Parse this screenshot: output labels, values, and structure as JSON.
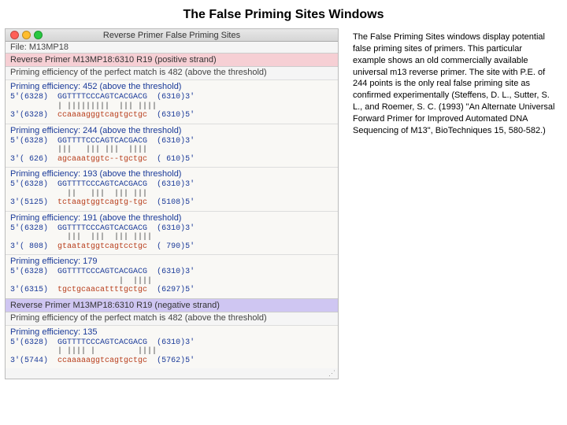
{
  "page_title": "The False Priming Sites Windows",
  "description": "The False Priming Sites windows display potential false priming sites of primers. This particular example shows an old commercially available universal m13 reverse primer. The site with P.E. of 244 points is the only real false priming site as confirmed experimentally (Steffens, D. L., Sutter, S. L., and Roemer, S. C. (1993) \"An Alternate Universal Forward Primer for Improved Automated DNA Sequencing of M13\", BioTechniques 15, 580-582.)",
  "window": {
    "title": "Reverse Primer False Priming Sites",
    "file": "File: M13MP18",
    "resize": "⋰"
  },
  "pos_strand": {
    "header": "Reverse Primer M13MP18:6310 R19 (positive strand)",
    "eff": "Priming efficiency of the perfect match is 482 (above the threshold)"
  },
  "neg_strand": {
    "header": "Reverse Primer M13MP18:6310 R19 (negative strand)",
    "eff": "Priming efficiency of the perfect match is 482 (above the threshold)"
  },
  "primer": {
    "pos5": "5'(6328)",
    "seq": "GGTTTTCCCAGTCACGACG",
    "end": "(6310)3'"
  },
  "sites_pos": [
    {
      "title": "Priming efficiency: 452 (above the threshold)",
      "align": "          | |||||||||  ||| ||||",
      "bpos": "3'(6328)",
      "bseq": "ccaaaagggtcagtgctgc",
      "bend": "(6310)5'"
    },
    {
      "title": "Priming efficiency: 244 (above the threshold)",
      "align": "          |||   ||| |||  ||||",
      "bpos": "3'( 626)",
      "bseq": "agcaaatggtc--tgctgc",
      "bend": "( 610)5'"
    },
    {
      "title": "Priming efficiency: 193 (above the threshold)",
      "align": "            ||   |||  ||| |||",
      "bpos": "3'(5125)",
      "bseq": "tctaagtggtcagtg-tgc",
      "bend": "(5108)5'"
    },
    {
      "title": "Priming efficiency: 191 (above the threshold)",
      "align": "            |||  |||  ||| ||||",
      "bpos": "3'( 808)",
      "bseq": "gtaatatggtcagtcctgc",
      "bend": "( 790)5'"
    },
    {
      "title": "Priming efficiency: 179",
      "align": "                       |  ||||",
      "bpos": "3'(6315)",
      "bseq": "tgctgcaacattttgctgc",
      "bend": "(6297)5'"
    }
  ],
  "sites_neg": [
    {
      "title": "Priming efficiency: 135",
      "align": "          | |||| |         ||||",
      "bpos": "3'(5744)",
      "bseq": "ccaaaaaggtcagtgctgc",
      "bend": "(5762)5'"
    }
  ]
}
